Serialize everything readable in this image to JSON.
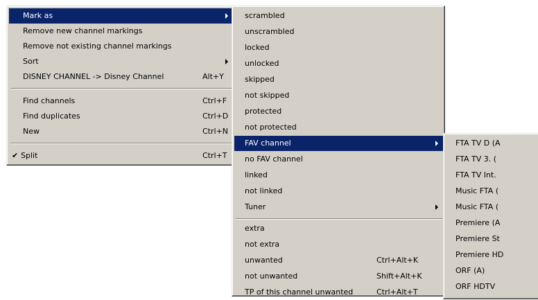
{
  "menu1": {
    "items": [
      {
        "label": "Mark as",
        "shortcut": "",
        "submenu": true,
        "selected": true
      },
      {
        "label": "Remove new channel markings",
        "shortcut": ""
      },
      {
        "label": "Remove not existing channel markings",
        "shortcut": ""
      },
      {
        "label": "Sort",
        "shortcut": "",
        "submenu": true
      },
      {
        "label": "DISNEY CHANNEL -> Disney Channel",
        "shortcut": "Alt+Y"
      },
      {
        "label": "Find channels",
        "shortcut": "Ctrl+F"
      },
      {
        "label": "Find duplicates",
        "shortcut": "Ctrl+D"
      },
      {
        "label": "New",
        "shortcut": "Ctrl+N"
      },
      {
        "label": "Split",
        "shortcut": "Ctrl+T",
        "checked": true,
        "check_glyph": "✔"
      }
    ]
  },
  "menu2": {
    "items": [
      {
        "label": "scrambled",
        "shortcut": ""
      },
      {
        "label": "unscrambled",
        "shortcut": ""
      },
      {
        "label": "locked",
        "shortcut": ""
      },
      {
        "label": "unlocked",
        "shortcut": ""
      },
      {
        "label": "skipped",
        "shortcut": ""
      },
      {
        "label": "not skipped",
        "shortcut": ""
      },
      {
        "label": "protected",
        "shortcut": ""
      },
      {
        "label": "not protected",
        "shortcut": ""
      },
      {
        "label": "FAV channel",
        "shortcut": "",
        "submenu": true,
        "selected": true
      },
      {
        "label": "no FAV channel",
        "shortcut": ""
      },
      {
        "label": "linked",
        "shortcut": ""
      },
      {
        "label": "not linked",
        "shortcut": ""
      },
      {
        "label": "Tuner",
        "shortcut": "",
        "submenu": true
      },
      {
        "label": "extra",
        "shortcut": ""
      },
      {
        "label": "not extra",
        "shortcut": ""
      },
      {
        "label": "unwanted",
        "shortcut": "Ctrl+Alt+K"
      },
      {
        "label": "not unwanted",
        "shortcut": "Shift+Alt+K"
      },
      {
        "label": "TP of this channel unwanted",
        "shortcut": "Ctrl+Alt+T"
      }
    ]
  },
  "menu3": {
    "items": [
      {
        "label": "FTA TV D (A"
      },
      {
        "label": "FTA TV 3. ("
      },
      {
        "label": "FTA TV Int."
      },
      {
        "label": "Music FTA ("
      },
      {
        "label": "Music FTA ("
      },
      {
        "label": "Premiere (A"
      },
      {
        "label": "Premiere St"
      },
      {
        "label": "Premiere HD"
      },
      {
        "label": "ORF (A)"
      },
      {
        "label": "ORF HDTV"
      }
    ]
  },
  "colors": {
    "menu_bg": "#d4d0c8",
    "highlight_bg": "#0a246a",
    "highlight_text": "#ffffff"
  }
}
